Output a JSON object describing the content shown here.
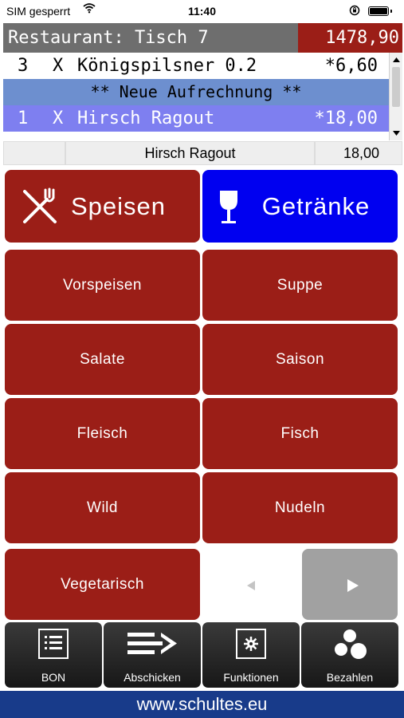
{
  "status_bar": {
    "carrier": "SIM gesperrt",
    "time": "11:40"
  },
  "header": {
    "title": "Restaurant: Tisch 7",
    "total": "1478,90"
  },
  "order": {
    "rows": [
      {
        "qty": "3",
        "x": "X",
        "name": "Königspilsner 0.2",
        "price": "*6,60"
      },
      {
        "qty": "1",
        "x": "X",
        "name": "Hirsch Ragout",
        "price": "*18,00"
      }
    ],
    "separator": "** Neue Aufrechnung **"
  },
  "info_bar": {
    "item": "Hirsch Ragout",
    "price": "18,00"
  },
  "main_categories": {
    "food": "Speisen",
    "drinks": "Getränke"
  },
  "subcategories": [
    "Vorspeisen",
    "Suppe",
    "Salate",
    "Saison",
    "Fleisch",
    "Fisch",
    "Wild",
    "Nudeln",
    "Vegetarisch"
  ],
  "toolbar": {
    "bon": "BON",
    "send": "Abschicken",
    "functions": "Funktionen",
    "pay": "Bezahlen"
  },
  "footer": {
    "url": "www.schultes.eu"
  },
  "colors": {
    "red": "#9b1e17",
    "blue": "#0000f0",
    "separator_blue": "#6d8fcf",
    "selected_row": "#7e7ff0",
    "footer_blue": "#183b8a"
  }
}
